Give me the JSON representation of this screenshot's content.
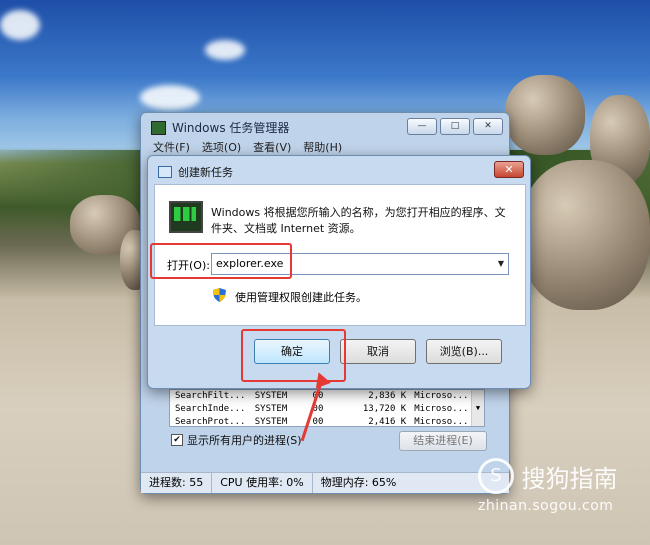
{
  "task_manager": {
    "title": "Windows 任务管理器",
    "controls": {
      "minimize": "—",
      "maximize": "□",
      "close": "✕"
    },
    "menu": [
      "文件(F)",
      "选项(O)",
      "查看(V)",
      "帮助(H)"
    ],
    "processes": [
      {
        "name": "SearchFilt...",
        "user": "SYSTEM",
        "cpu": "00",
        "mem": "2,836 K",
        "desc": "Microso..."
      },
      {
        "name": "SearchInde...",
        "user": "SYSTEM",
        "cpu": "00",
        "mem": "13,720 K",
        "desc": "Microso..."
      },
      {
        "name": "SearchProt...",
        "user": "SYSTEM",
        "cpu": "00",
        "mem": "2,416 K",
        "desc": "Microso..."
      }
    ],
    "show_all_label": "显示所有用户的进程(S)",
    "end_process_label": "结束进程(E)",
    "status": {
      "processes": "进程数: 55",
      "cpu": "CPU 使用率: 0%",
      "memory": "物理内存: 65%"
    }
  },
  "dialog": {
    "title": "创建新任务",
    "close": "✕",
    "description": "Windows 将根据您所输入的名称，为您打开相应的程序、文件夹、文档或 Internet 资源。",
    "open_label": "打开(O):",
    "open_value": "explorer.exe",
    "admin_label": "使用管理权限创建此任务。",
    "ok_label": "确定",
    "cancel_label": "取消",
    "browse_label": "浏览(B)..."
  },
  "watermark": {
    "logo": "S",
    "brand": "搜狗指南",
    "url": "zhinan.sogou.com"
  },
  "colors": {
    "highlight": "#e53935",
    "accent": "#3c7fb1"
  }
}
